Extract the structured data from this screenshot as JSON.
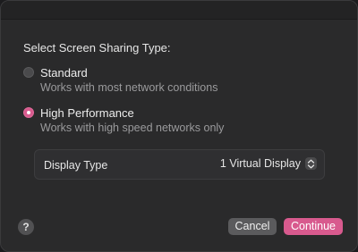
{
  "dialog": {
    "heading": "Select Screen Sharing Type:",
    "options": [
      {
        "label": "Standard",
        "description": "Works with most network conditions",
        "selected": false
      },
      {
        "label": "High Performance",
        "description": "Works with high speed networks only",
        "selected": true
      }
    ],
    "display_type": {
      "label": "Display Type",
      "value": "1 Virtual Display"
    },
    "help_label": "?",
    "cancel_label": "Cancel",
    "continue_label": "Continue",
    "accent_color": "#d85a8e",
    "icons": [
      "help-icon",
      "up-down-chevron-icon"
    ]
  }
}
